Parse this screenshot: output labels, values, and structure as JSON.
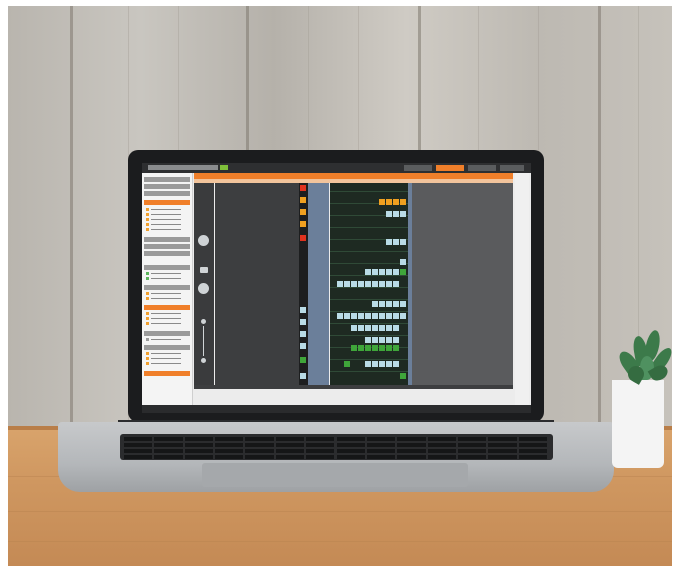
{
  "scene": {
    "description_role": "photo-mockup",
    "colors": {
      "accent": "#f07f2a",
      "cell_red": "#e0321e",
      "cell_orange": "#f0a020",
      "cell_light": "#b9dbe6",
      "cell_green": "#3fa63a"
    }
  },
  "app": {
    "top_tabs": [
      "",
      "",
      "",
      "",
      ""
    ],
    "active_tab_index": 1
  },
  "icons": {
    "compass": "compass-icon",
    "pan": "pan-control-icon",
    "zoom": "zoom-slider-icon",
    "plant": "plant-icon"
  }
}
